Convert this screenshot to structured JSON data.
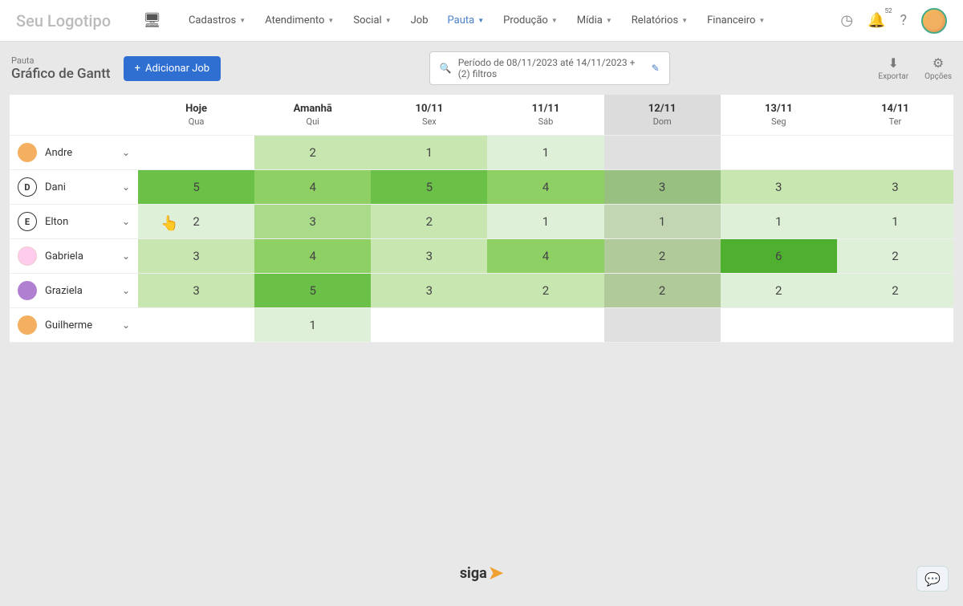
{
  "header": {
    "logo": "Seu Logotipo",
    "nav": [
      {
        "label": "Cadastros"
      },
      {
        "label": "Atendimento"
      },
      {
        "label": "Social"
      },
      {
        "label": "Job",
        "nocaret": true
      },
      {
        "label": "Pauta",
        "active": true
      },
      {
        "label": "Produção"
      },
      {
        "label": "Mídia"
      },
      {
        "label": "Relatórios"
      },
      {
        "label": "Financeiro"
      }
    ],
    "notif_badge": "52"
  },
  "page": {
    "breadcrumb": "Pauta",
    "title": "Gráfico de Gantt",
    "add_btn": "Adicionar Job",
    "search_text": "Período de 08/11/2023 até 14/11/2023 + (2) filtros",
    "export_label": "Exportar",
    "options_label": "Opções"
  },
  "columns": [
    {
      "label": "Hoje",
      "sub": "Qua",
      "weekend": false
    },
    {
      "label": "Amanhã",
      "sub": "Qui",
      "weekend": false
    },
    {
      "label": "10/11",
      "sub": "Sex",
      "weekend": false
    },
    {
      "label": "11/11",
      "sub": "Sáb",
      "weekend": false
    },
    {
      "label": "12/11",
      "sub": "Dom",
      "weekend": true
    },
    {
      "label": "13/11",
      "sub": "Seg",
      "weekend": false
    },
    {
      "label": "14/11",
      "sub": "Ter",
      "weekend": false
    }
  ],
  "rows": [
    {
      "name": "Andre",
      "avatar": "",
      "avclass": "av-0",
      "cells": [
        {
          "v": "",
          "g": 0
        },
        {
          "v": "2",
          "g": 2
        },
        {
          "v": "1",
          "g": 2
        },
        {
          "v": "1",
          "g": 1
        },
        {
          "v": "",
          "g": 0,
          "wk": true
        },
        {
          "v": "",
          "g": 0
        },
        {
          "v": "",
          "g": 0
        }
      ]
    },
    {
      "name": "Dani",
      "avatar": "D",
      "avclass": "av-1",
      "cells": [
        {
          "v": "5",
          "g": 5
        },
        {
          "v": "4",
          "g": 4
        },
        {
          "v": "5",
          "g": 5
        },
        {
          "v": "4",
          "g": 4
        },
        {
          "v": "3",
          "g": 3,
          "wk": true
        },
        {
          "v": "3",
          "g": 2
        },
        {
          "v": "3",
          "g": 2
        }
      ]
    },
    {
      "name": "Elton",
      "avatar": "E",
      "avclass": "av-2",
      "cells": [
        {
          "v": "2",
          "g": 1
        },
        {
          "v": "3",
          "g": 3
        },
        {
          "v": "2",
          "g": 2
        },
        {
          "v": "1",
          "g": 1
        },
        {
          "v": "1",
          "g": 1,
          "wk": true
        },
        {
          "v": "1",
          "g": 1
        },
        {
          "v": "1",
          "g": 1
        }
      ]
    },
    {
      "name": "Gabriela",
      "avatar": "",
      "avclass": "av-3",
      "cells": [
        {
          "v": "3",
          "g": 2
        },
        {
          "v": "4",
          "g": 4
        },
        {
          "v": "3",
          "g": 2
        },
        {
          "v": "4",
          "g": 4
        },
        {
          "v": "2",
          "g": 2,
          "wk": true
        },
        {
          "v": "6",
          "g": 6
        },
        {
          "v": "2",
          "g": 1
        }
      ]
    },
    {
      "name": "Graziela",
      "avatar": "",
      "avclass": "av-4",
      "cells": [
        {
          "v": "3",
          "g": 2
        },
        {
          "v": "5",
          "g": 5
        },
        {
          "v": "3",
          "g": 2
        },
        {
          "v": "2",
          "g": 2
        },
        {
          "v": "2",
          "g": 2,
          "wk": true
        },
        {
          "v": "2",
          "g": 1
        },
        {
          "v": "2",
          "g": 1
        }
      ]
    },
    {
      "name": "Guilherme",
      "avatar": "",
      "avclass": "av-5",
      "cells": [
        {
          "v": "",
          "g": 0
        },
        {
          "v": "1",
          "g": 1
        },
        {
          "v": "",
          "g": 0
        },
        {
          "v": "",
          "g": 0
        },
        {
          "v": "",
          "g": 0,
          "wk": true
        },
        {
          "v": "",
          "g": 0
        },
        {
          "v": "",
          "g": 0
        }
      ]
    }
  ],
  "footer_logo": "siga"
}
